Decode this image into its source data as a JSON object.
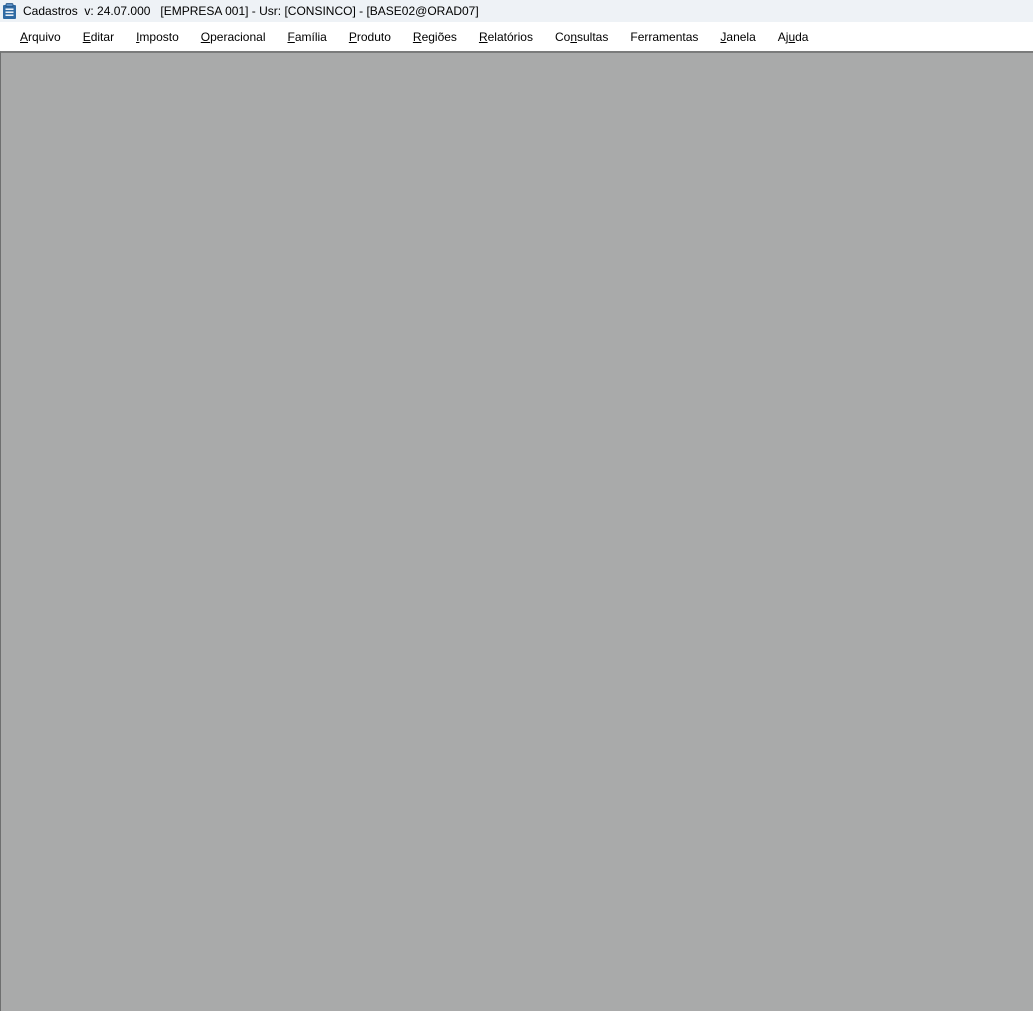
{
  "window": {
    "title": "Cadastros  v: 24.07.000   [EMPRESA 001] - Usr: [CONSINCO] - [BASE02@ORAD07]",
    "icon": "clipboard-app-icon"
  },
  "menubar": {
    "items": [
      {
        "pre": "",
        "mnemonic": "A",
        "post": "rquivo"
      },
      {
        "pre": "",
        "mnemonic": "E",
        "post": "ditar"
      },
      {
        "pre": "",
        "mnemonic": "I",
        "post": "mposto"
      },
      {
        "pre": "",
        "mnemonic": "O",
        "post": "peracional"
      },
      {
        "pre": "",
        "mnemonic": "F",
        "post": "amília"
      },
      {
        "pre": "",
        "mnemonic": "P",
        "post": "roduto"
      },
      {
        "pre": "",
        "mnemonic": "R",
        "post": "egiões"
      },
      {
        "pre": "",
        "mnemonic": "R",
        "post": "elatórios"
      },
      {
        "pre": "Co",
        "mnemonic": "n",
        "post": "sultas"
      },
      {
        "pre": "Ferramentas",
        "mnemonic": "",
        "post": ""
      },
      {
        "pre": "",
        "mnemonic": "J",
        "post": "anela"
      },
      {
        "pre": "Aj",
        "mnemonic": "u",
        "post": "da"
      }
    ]
  },
  "colors": {
    "titlebar_bg": "#eef2f6",
    "mdi_bg": "#a9aaaa",
    "icon_blue": "#2f6aa3"
  }
}
